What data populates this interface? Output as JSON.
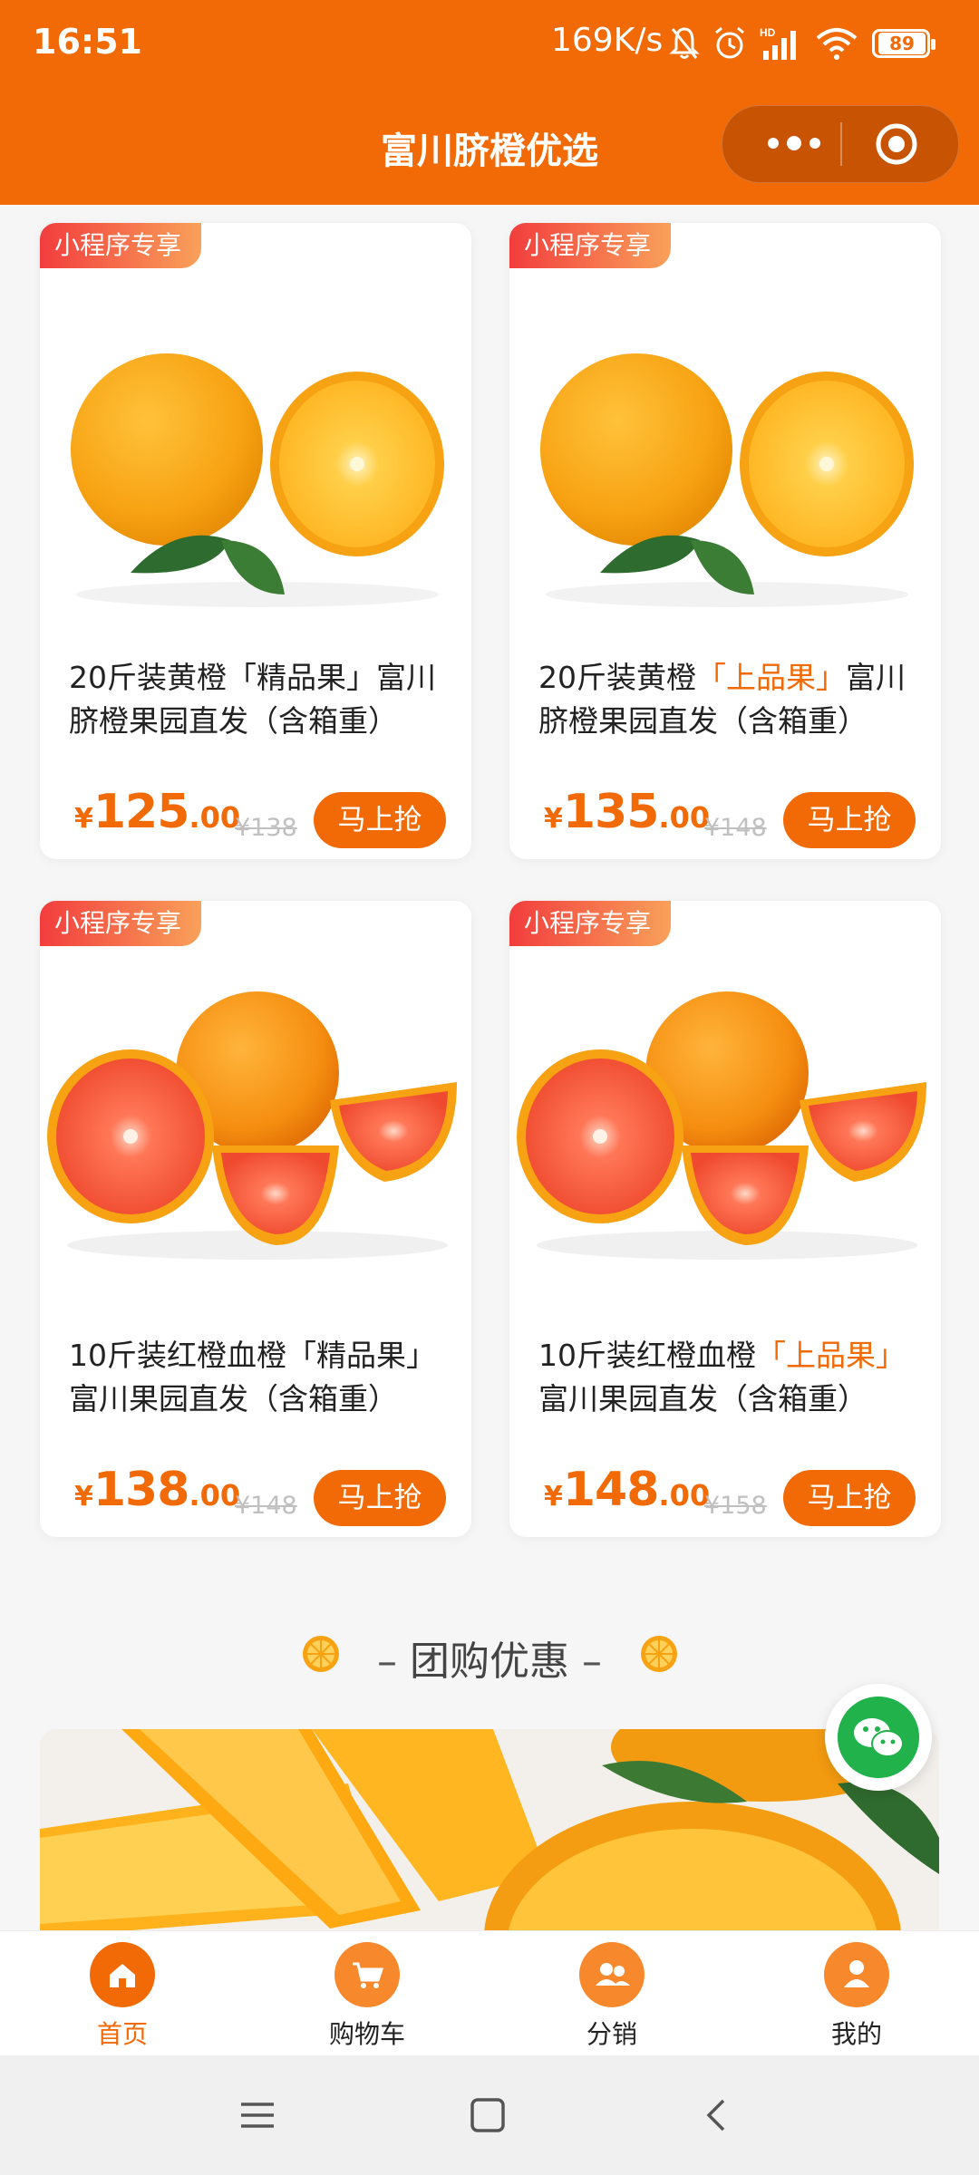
{
  "status_bar": {
    "time": "16:51",
    "network_rate": "169K/s",
    "battery": "89",
    "icons": [
      "mute-bell-icon",
      "alarm-icon",
      "hd-signal-icon",
      "wifi-icon",
      "battery-icon"
    ]
  },
  "navbar": {
    "title": "富川脐橙优选",
    "capsule_icons": [
      "more-dots-icon",
      "close-target-icon"
    ]
  },
  "products": [
    {
      "tag": "小程序专享",
      "name_pre": "20斤装黄橙",
      "name_hl": "「精品果」",
      "name_post": "富川脐橙果园直发（含箱重）",
      "highlight": false,
      "currency": "¥",
      "price_int": "125",
      "price_dec": ".00",
      "orig": "¥138",
      "buy": "马上抢",
      "image": "navel-orange-photo"
    },
    {
      "tag": "小程序专享",
      "name_pre": "20斤装黄橙",
      "name_hl": "「上品果」",
      "name_post": "富川脐橙果园直发（含箱重）",
      "highlight": true,
      "currency": "¥",
      "price_int": "135",
      "price_dec": ".00",
      "orig": "¥148",
      "buy": "马上抢",
      "image": "navel-orange-photo"
    },
    {
      "tag": "小程序专享",
      "name_pre": "10斤装红橙血橙",
      "name_hl": "「精品果」",
      "name_post": "富川果园直发（含箱重）",
      "highlight": false,
      "currency": "¥",
      "price_int": "138",
      "price_dec": ".00",
      "orig": "¥148",
      "buy": "马上抢",
      "image": "blood-orange-photo"
    },
    {
      "tag": "小程序专享",
      "name_pre": "10斤装红橙血橙",
      "name_hl": "「上品果」",
      "name_post": "富川果园直发（含箱重）",
      "highlight": true,
      "currency": "¥",
      "price_int": "148",
      "price_dec": ".00",
      "orig": "¥158",
      "buy": "马上抢",
      "image": "blood-orange-photo"
    }
  ],
  "section": {
    "dash": "–",
    "title": "团购优惠",
    "icon": "orange-slice-icon"
  },
  "tabbar": [
    {
      "label": "首页",
      "icon": "home-icon",
      "active": true
    },
    {
      "label": "购物车",
      "icon": "cart-icon",
      "active": false
    },
    {
      "label": "分销",
      "icon": "users-icon",
      "active": false
    },
    {
      "label": "我的",
      "icon": "person-icon",
      "active": false
    }
  ],
  "system_nav": [
    "menu-icon",
    "home-square-icon",
    "back-icon"
  ],
  "colors": {
    "brand": "#f26a06",
    "tag_start": "#f23d3d",
    "tag_end": "#f9a15a",
    "wechat": "#22b24c"
  }
}
